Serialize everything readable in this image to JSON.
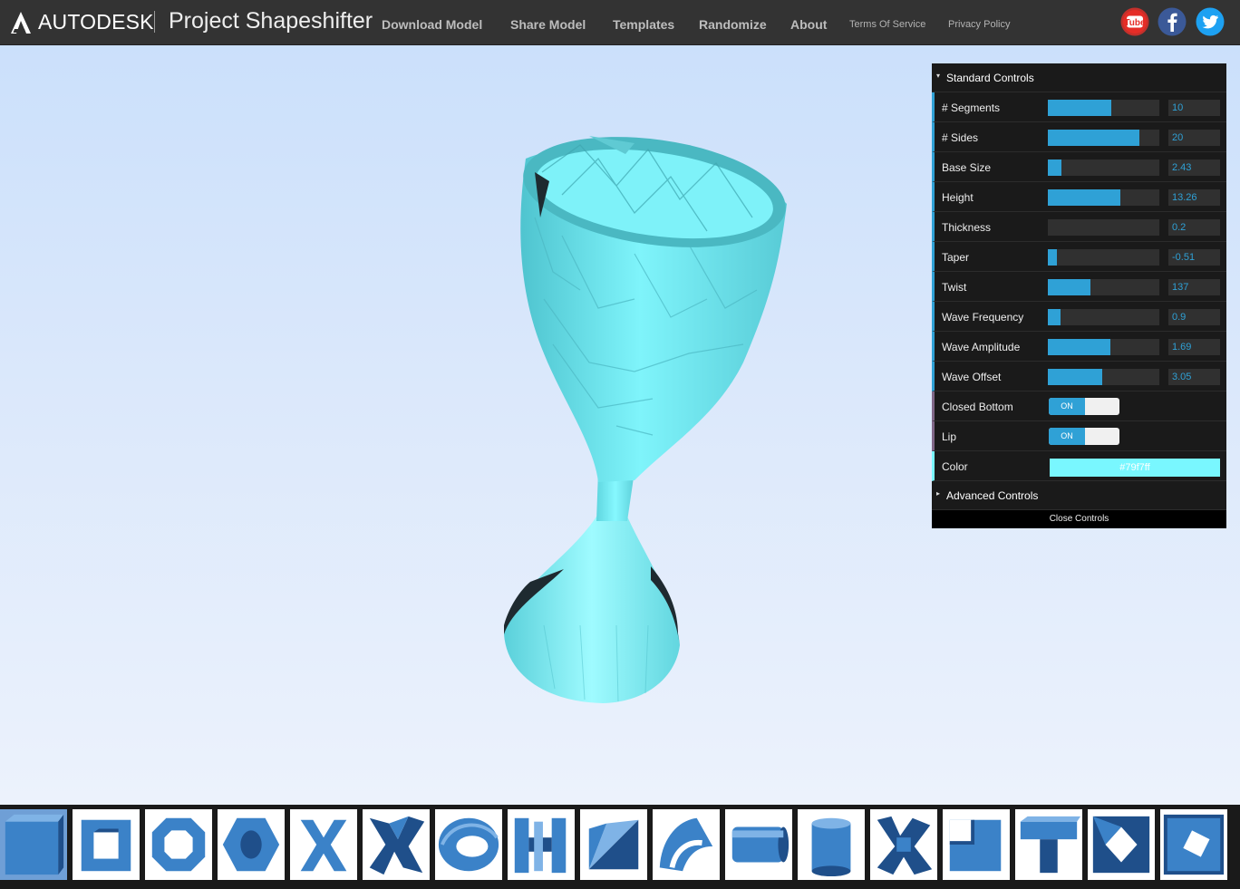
{
  "header": {
    "brand": "AUTODESK",
    "app_title": "Project Shapeshifter",
    "logo_icon": "autodesk-logo-icon",
    "nav": [
      {
        "label": "Download Model"
      },
      {
        "label": "Share Model"
      },
      {
        "label": "Templates"
      },
      {
        "label": "Randomize"
      },
      {
        "label": "About"
      }
    ],
    "small_links": [
      {
        "label": "Terms Of Service"
      },
      {
        "label": "Privacy Policy"
      }
    ],
    "social": [
      {
        "icon": "youtube-icon",
        "label": "Tube",
        "color": "#e52d27"
      },
      {
        "icon": "facebook-icon",
        "color": "#3b5998"
      },
      {
        "icon": "twitter-icon",
        "color": "#1da1f2"
      }
    ]
  },
  "controls": {
    "standard_title": "Standard Controls",
    "advanced_title": "Advanced Controls",
    "close_label": "Close Controls",
    "sliders": [
      {
        "label": "# Segments",
        "value": "10",
        "fraction": 0.57
      },
      {
        "label": "# Sides",
        "value": "20",
        "fraction": 0.82
      },
      {
        "label": "Base Size",
        "value": "2.43",
        "fraction": 0.12
      },
      {
        "label": "Height",
        "value": "13.26",
        "fraction": 0.65
      },
      {
        "label": "Thickness",
        "value": "0.2",
        "fraction": 0.0
      },
      {
        "label": "Taper",
        "value": "-0.51",
        "fraction": 0.08
      },
      {
        "label": "Twist",
        "value": "137",
        "fraction": 0.38
      },
      {
        "label": "Wave Frequency",
        "value": "0.9",
        "fraction": 0.11
      },
      {
        "label": "Wave Amplitude",
        "value": "1.69",
        "fraction": 0.56
      },
      {
        "label": "Wave Offset",
        "value": "3.05",
        "fraction": 0.49
      }
    ],
    "toggles": [
      {
        "label": "Closed Bottom",
        "state": "ON"
      },
      {
        "label": "Lip",
        "state": "ON"
      }
    ],
    "color": {
      "label": "Color",
      "value": "#79f7ff"
    }
  },
  "colors": {
    "accent": "#2fa1d6",
    "model": "#79f7ff",
    "shape_blue": "#3b82c8"
  },
  "templates": [
    {
      "icon": "cube-shape-icon",
      "selected": true
    },
    {
      "icon": "square-frame-shape-icon"
    },
    {
      "icon": "octagon-ring-shape-icon"
    },
    {
      "icon": "hex-ring-shape-icon"
    },
    {
      "icon": "x-shape-icon"
    },
    {
      "icon": "twisted-x-shape-icon"
    },
    {
      "icon": "eye-ring-shape-icon"
    },
    {
      "icon": "h-shape-icon"
    },
    {
      "icon": "wedge-shape-icon"
    },
    {
      "icon": "curved-arch-shape-icon"
    },
    {
      "icon": "cylinder-side-shape-icon"
    },
    {
      "icon": "cylinder-upright-shape-icon"
    },
    {
      "icon": "twisted-h-shape-icon"
    },
    {
      "icon": "corner-block-shape-icon"
    },
    {
      "icon": "t-block-shape-icon"
    },
    {
      "icon": "star-cut-shape-icon"
    },
    {
      "icon": "rotated-square-shape-icon"
    }
  ]
}
